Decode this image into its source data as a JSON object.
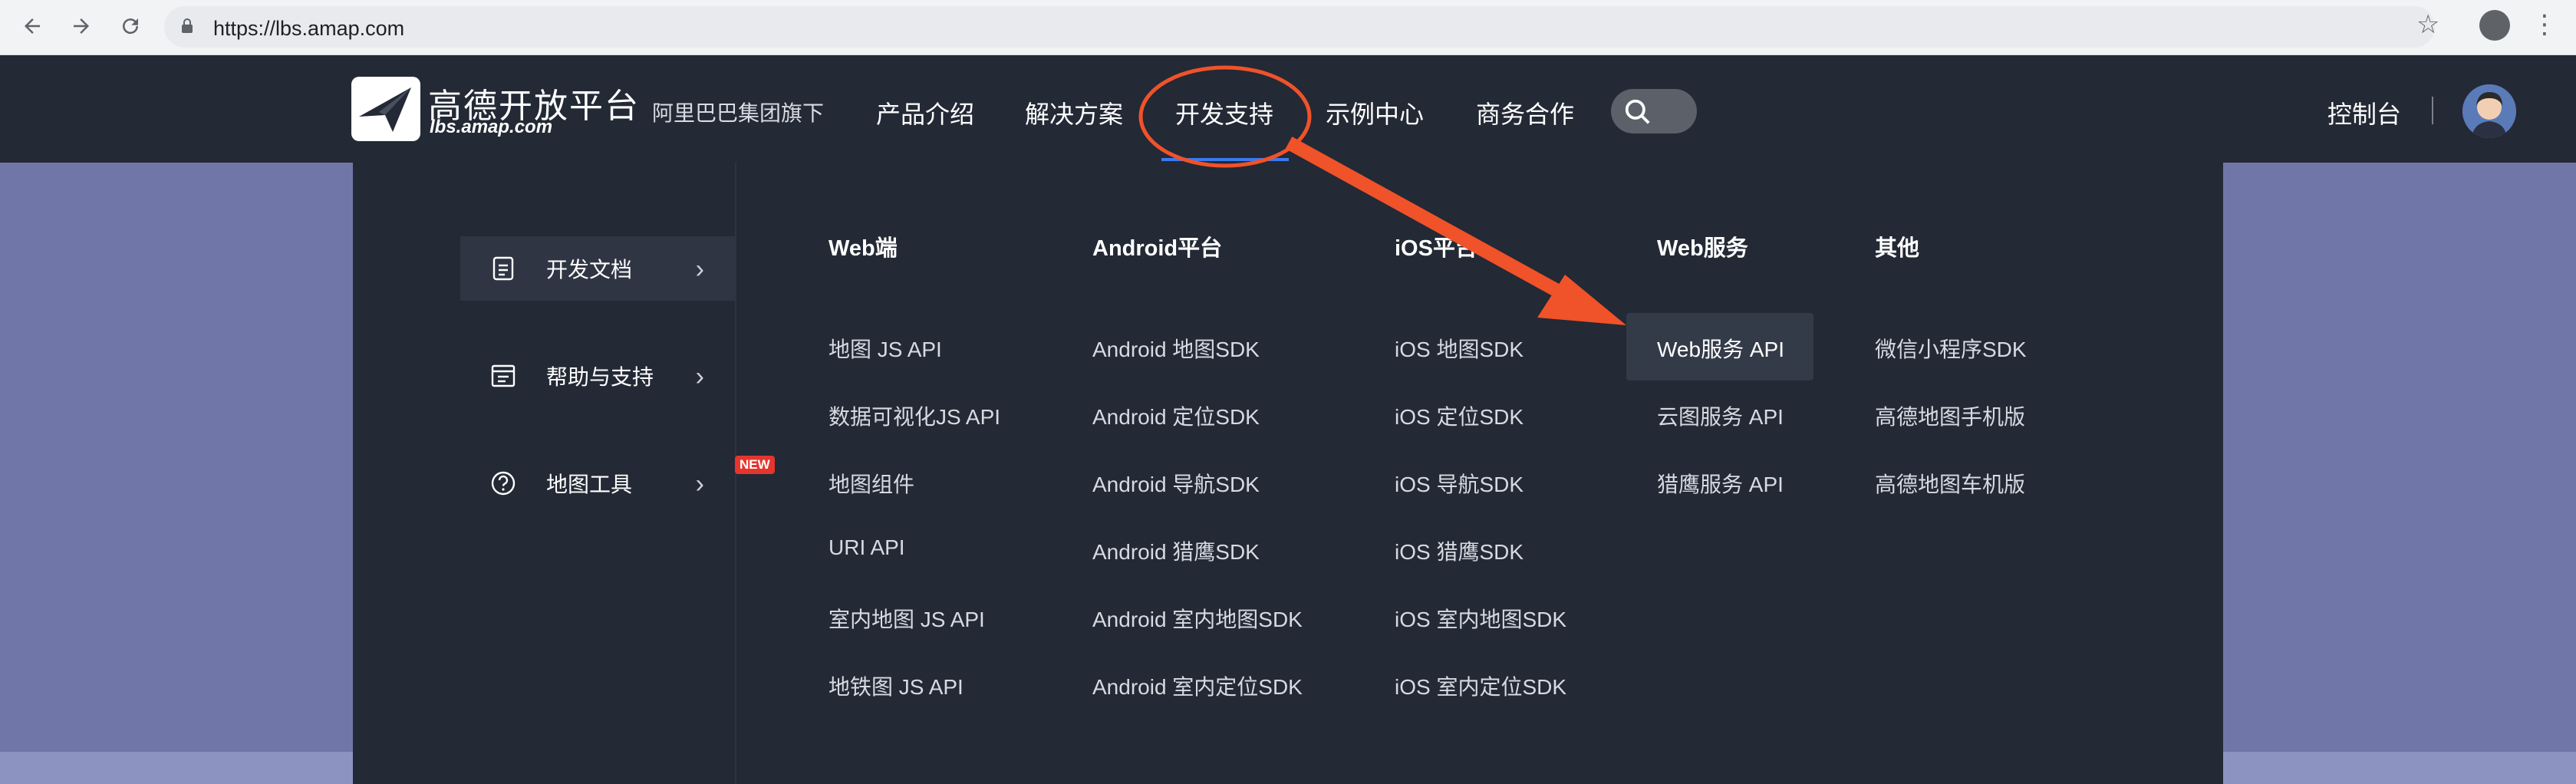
{
  "browser": {
    "url": "https://lbs.amap.com",
    "back_icon": "back-arrow-icon",
    "forward_icon": "forward-arrow-icon",
    "reload_icon": "reload-icon"
  },
  "header": {
    "logo_title": "高德开放平台",
    "logo_sub": "lbs.amap.com",
    "tagline": "阿里巴巴集团旗下",
    "nav": [
      "产品介绍",
      "解决方案",
      "开发支持",
      "示例中心",
      "商务合作"
    ],
    "active_nav": "开发支持",
    "console": "控制台"
  },
  "sidebar": {
    "items": [
      {
        "label": "开发文档",
        "icon": "document-icon",
        "active": true
      },
      {
        "label": "帮助与支持",
        "icon": "help-panel-icon",
        "active": false
      },
      {
        "label": "地图工具",
        "icon": "question-circle-icon",
        "active": false,
        "badge": "NEW"
      }
    ]
  },
  "columns": [
    {
      "title": "Web端",
      "links": [
        "地图 JS API",
        "数据可视化JS API",
        "地图组件",
        "URI API",
        "室内地图 JS API",
        "地铁图 JS API"
      ]
    },
    {
      "title": "Android平台",
      "links": [
        "Android 地图SDK",
        "Android 定位SDK",
        "Android 导航SDK",
        "Android 猎鹰SDK",
        "Android 室内地图SDK",
        "Android 室内定位SDK"
      ]
    },
    {
      "title": "iOS平台",
      "links": [
        "iOS 地图SDK",
        "iOS 定位SDK",
        "iOS 导航SDK",
        "iOS 猎鹰SDK",
        "iOS 室内地图SDK",
        "iOS 室内定位SDK"
      ]
    },
    {
      "title": "Web服务",
      "links": [
        "Web服务 API",
        "云图服务 API",
        "猎鹰服务 API"
      ]
    },
    {
      "title": "其他",
      "links": [
        "微信小程序SDK",
        "高德地图手机版",
        "高德地图车机版"
      ]
    }
  ],
  "highlighted_link": "Web服务 API",
  "colors": {
    "header_bg": "#232935",
    "accent": "#3b7af0",
    "annotation": "#f0522a",
    "badge": "#e5352c"
  }
}
